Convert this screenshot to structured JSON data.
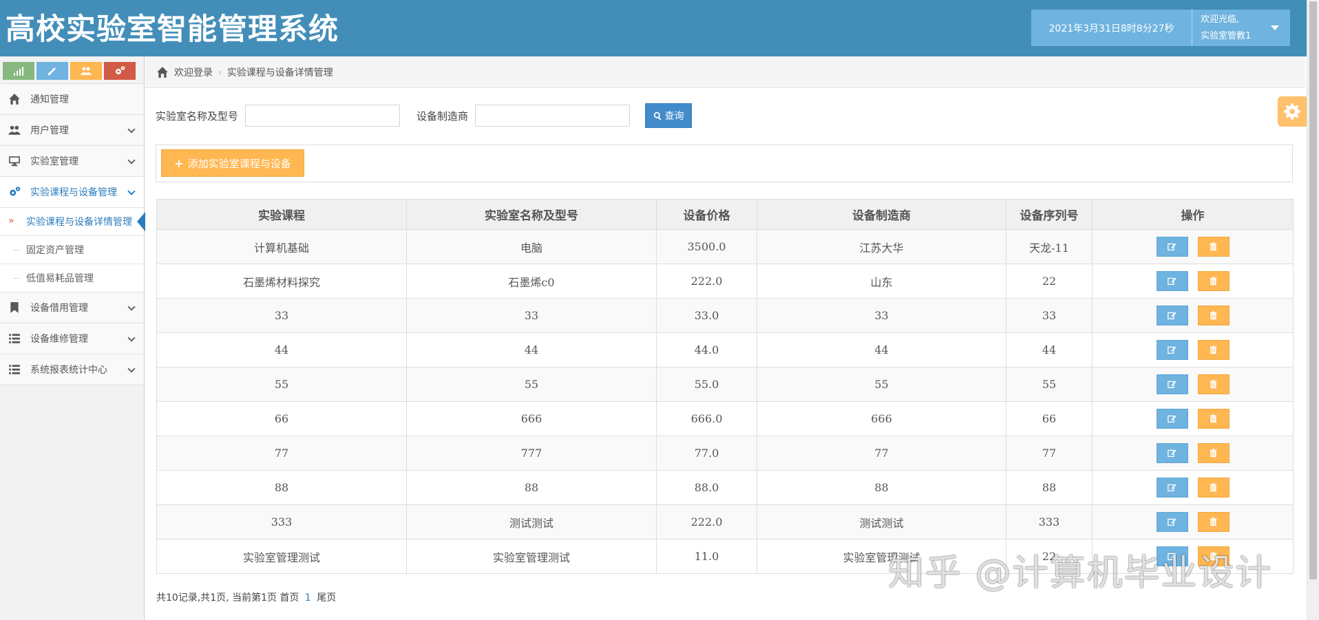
{
  "header": {
    "app_title": "高校实验室智能管理系统",
    "datetime": "2021年3月31日8时8分27秒",
    "welcome": "欢迎光临,",
    "username": "实验室管教1"
  },
  "sidebar": {
    "shortcuts": [
      {
        "icon": "signal-icon",
        "color": "#87b87f"
      },
      {
        "icon": "pencil-icon",
        "color": "#6fb3e0"
      },
      {
        "icon": "users-icon",
        "color": "#ffb752"
      },
      {
        "icon": "cogs-icon",
        "color": "#d15b47"
      }
    ],
    "items": [
      {
        "label": "通知管理",
        "icon": "home-icon"
      },
      {
        "label": "用户管理",
        "icon": "users-icon"
      },
      {
        "label": "实验室管理",
        "icon": "desktop-icon"
      },
      {
        "label": "实验课程与设备管理",
        "icon": "cogs-icon"
      },
      {
        "label": "设备借用管理",
        "icon": "bookmark-icon"
      },
      {
        "label": "设备维修管理",
        "icon": "list-icon"
      },
      {
        "label": "系统报表统计中心",
        "icon": "list-icon"
      }
    ],
    "submenu": [
      {
        "label": "实验课程与设备详情管理"
      },
      {
        "label": "固定资产管理"
      },
      {
        "label": "低值易耗品管理"
      }
    ]
  },
  "breadcrumb": {
    "home": "欢迎登录",
    "current": "实验课程与设备详情管理"
  },
  "search": {
    "lab_label": "实验室名称及型号",
    "lab_value": "",
    "maker_label": "设备制造商",
    "maker_value": "",
    "query_label": "查询"
  },
  "add_button": "添加实验室课程与设备",
  "table": {
    "headers": [
      "实验课程",
      "实验室名称及型号",
      "设备价格",
      "设备制造商",
      "设备序列号",
      "操作"
    ],
    "rows": [
      [
        "计算机基础",
        "电脑",
        "3500.0",
        "江苏大华",
        "天龙-11"
      ],
      [
        "石墨烯材料探究",
        "石墨烯c0",
        "222.0",
        "山东",
        "22"
      ],
      [
        "33",
        "33",
        "33.0",
        "33",
        "33"
      ],
      [
        "44",
        "44",
        "44.0",
        "44",
        "44"
      ],
      [
        "55",
        "55",
        "55.0",
        "55",
        "55"
      ],
      [
        "66",
        "666",
        "666.0",
        "666",
        "66"
      ],
      [
        "77",
        "777",
        "77.0",
        "77",
        "77"
      ],
      [
        "88",
        "88",
        "88.0",
        "88",
        "88"
      ],
      [
        "333",
        "测试测试",
        "222.0",
        "测试测试",
        "333"
      ],
      [
        "实验室管理测试",
        "实验室管理测试",
        "11.0",
        "实验室管理测试",
        "22"
      ]
    ]
  },
  "pager": {
    "summary": "共10记录,共1页, 当前第1页",
    "first": "首页",
    "current": "1",
    "last": "尾页"
  },
  "watermark": "知乎 @计算机毕业设计",
  "colors": {
    "header_bg": "#438eb9",
    "primary": "#428bca",
    "info": "#6fb3e0",
    "warning": "#ffb752",
    "danger": "#d15b47",
    "success": "#87b87f"
  }
}
